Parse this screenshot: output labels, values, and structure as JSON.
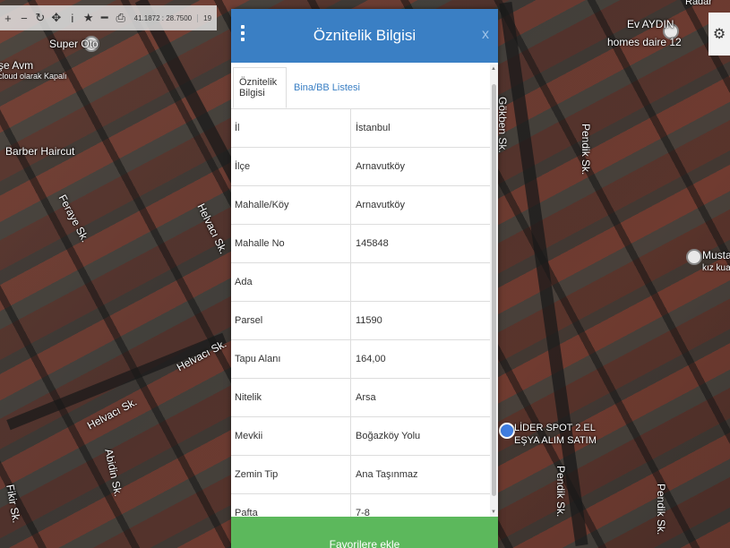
{
  "toolbar": {
    "buttons": [
      {
        "icon": "plus-icon",
        "glyph": "+"
      },
      {
        "icon": "minus-icon",
        "glyph": "−"
      },
      {
        "icon": "refresh-icon",
        "glyph": "↻"
      },
      {
        "icon": "move-icon",
        "glyph": "✥"
      },
      {
        "icon": "info-icon",
        "glyph": "i"
      },
      {
        "icon": "star-icon",
        "glyph": "★"
      },
      {
        "icon": "ruler-icon",
        "glyph": "━"
      },
      {
        "icon": "print-icon",
        "glyph": "⎙"
      }
    ],
    "coords": "41.1872 : 28.7500",
    "zoom": "19"
  },
  "map_labels": {
    "super_oto": "Super Oto",
    "avm_line1": "şe Avm",
    "avm_line2": "cloud olarak Kapalı",
    "barber": "Barber Haircut",
    "helvaci1": "Helvacı Sk.",
    "helvaci2": "Helvacı Sk.",
    "helvaci3": "Helvacı Sk.",
    "fikir": "Fikir Sk.",
    "abidin": "Abidin Sk.",
    "eraya": "Feraye Sk.",
    "evaydin1": "Ev AYDIN",
    "evaydin2": "homes daire 12",
    "gokben": "Gökben Sk.",
    "pendik1": "Pendik Sk.",
    "pendik2": "Pendik Sk.",
    "pendik3": "Pendik Sk.",
    "mustafa1": "Mustafa",
    "mustafa2": "kız kuaf",
    "lider1": "LİDER SPOT 2.EL",
    "lider2": "EŞYA ALIM SATIM",
    "radar": "Radar"
  },
  "dialog": {
    "title": "Öznitelik Bilgisi",
    "close": "x",
    "tabs": [
      "Öznitelik Bilgisi",
      "Bina/BB Listesi"
    ],
    "rows": [
      {
        "key": "İl",
        "value": "İstanbul"
      },
      {
        "key": "İlçe",
        "value": "Arnavutköy"
      },
      {
        "key": "Mahalle/Köy",
        "value": "Arnavutköy"
      },
      {
        "key": "Mahalle No",
        "value": "145848"
      },
      {
        "key": "Ada",
        "value": ""
      },
      {
        "key": "Parsel",
        "value": "11590"
      },
      {
        "key": "Tapu Alanı",
        "value": "164,00"
      },
      {
        "key": "Nitelik",
        "value": "Arsa"
      },
      {
        "key": "Mevkii",
        "value": "Boğazköy Yolu"
      },
      {
        "key": "Zemin Tip",
        "value": "Ana Taşınmaz"
      },
      {
        "key": "Pafta",
        "value": "7-8"
      }
    ],
    "favorite_button": "Favorilere ekle"
  },
  "colors": {
    "header": "#3a7fc4",
    "button": "#5cb85c"
  }
}
